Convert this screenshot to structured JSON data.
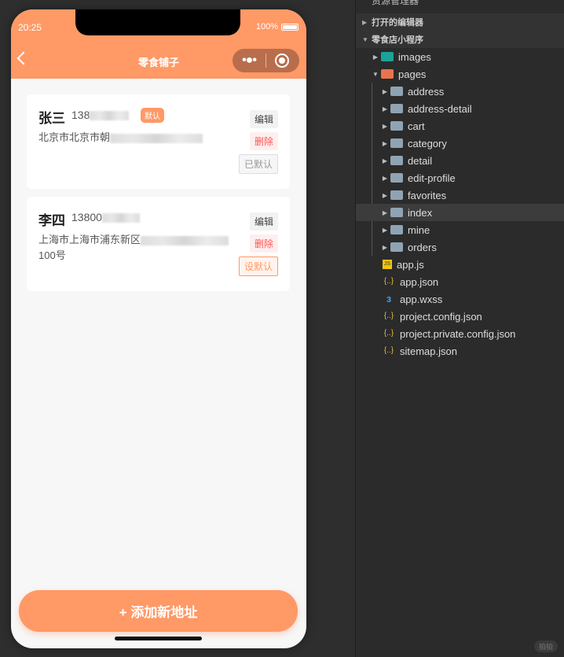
{
  "status": {
    "time": "20:25",
    "battery": "100%"
  },
  "nav": {
    "title": "零食铺子",
    "menu_icon": "more-dots-icon",
    "close_icon": "record-icon"
  },
  "addresses": [
    {
      "name": "张三",
      "phone": "138",
      "is_default": true,
      "default_tag": "默认",
      "address": "北京市北京市朝",
      "edit": "编辑",
      "delete": "删除",
      "default_button": "已默认"
    },
    {
      "name": "李四",
      "phone": "13800",
      "is_default": false,
      "address": "上海市上海市浦东新区",
      "address_tail": "100号",
      "edit": "编辑",
      "delete": "删除",
      "default_button": "设默认"
    }
  ],
  "add_button": "+ 添加新地址",
  "explorer": {
    "title": "资源管理器",
    "sections": [
      "打开的编辑器",
      "零食店小程序"
    ],
    "tree": [
      {
        "label": "images",
        "type": "folder-images"
      },
      {
        "label": "pages",
        "type": "folder-pages"
      },
      {
        "label": "address",
        "type": "folder"
      },
      {
        "label": "address-detail",
        "type": "folder"
      },
      {
        "label": "cart",
        "type": "folder"
      },
      {
        "label": "category",
        "type": "folder"
      },
      {
        "label": "detail",
        "type": "folder"
      },
      {
        "label": "edit-profile",
        "type": "folder"
      },
      {
        "label": "favorites",
        "type": "folder"
      },
      {
        "label": "index",
        "type": "folder"
      },
      {
        "label": "mine",
        "type": "folder"
      },
      {
        "label": "orders",
        "type": "folder"
      },
      {
        "label": "app.js",
        "type": "js"
      },
      {
        "label": "app.json",
        "type": "json"
      },
      {
        "label": "app.wxss",
        "type": "css"
      },
      {
        "label": "project.config.json",
        "type": "json"
      },
      {
        "label": "project.private.config.json",
        "type": "json"
      },
      {
        "label": "sitemap.json",
        "type": "json"
      }
    ],
    "badge": "拍拍"
  },
  "colors": {
    "accent": "#ff9966",
    "delete": "#ff5555"
  }
}
